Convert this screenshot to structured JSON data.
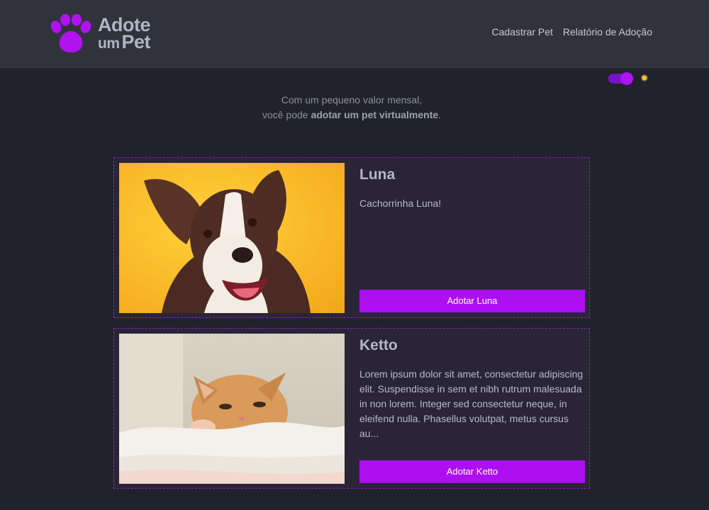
{
  "header": {
    "logo": {
      "line1": "Adote",
      "line2_small": "um",
      "line2_big": "Pet"
    },
    "nav": [
      {
        "label": "Cadastrar Pet"
      },
      {
        "label": "Relatório de Adoção"
      }
    ]
  },
  "theme_toggle": {
    "state": "dark",
    "icon": "sun-icon"
  },
  "intro": {
    "line1": "Com um pequeno valor mensal,",
    "line2_prefix": "você pode ",
    "line2_bold": "adotar um pet virtualmente",
    "line2_suffix": "."
  },
  "pets": [
    {
      "name": "Luna",
      "description": "Cachorrinha Luna!",
      "button": "Adotar Luna",
      "photo": "dog-photo"
    },
    {
      "name": "Ketto",
      "description": "Lorem ipsum dolor sit amet, consectetur adipiscing elit. Suspendisse in sem et nibh rutrum malesuada in non lorem. Integer sed consectetur neque, in eleifend nulla. Phasellus volutpat, metus cursus au...",
      "button": "Adotar Ketto",
      "photo": "kitten-photo"
    }
  ],
  "colors": {
    "accent": "#ad0ff0",
    "background": "#20232c",
    "header": "#30333c",
    "card": "#2a2437"
  }
}
